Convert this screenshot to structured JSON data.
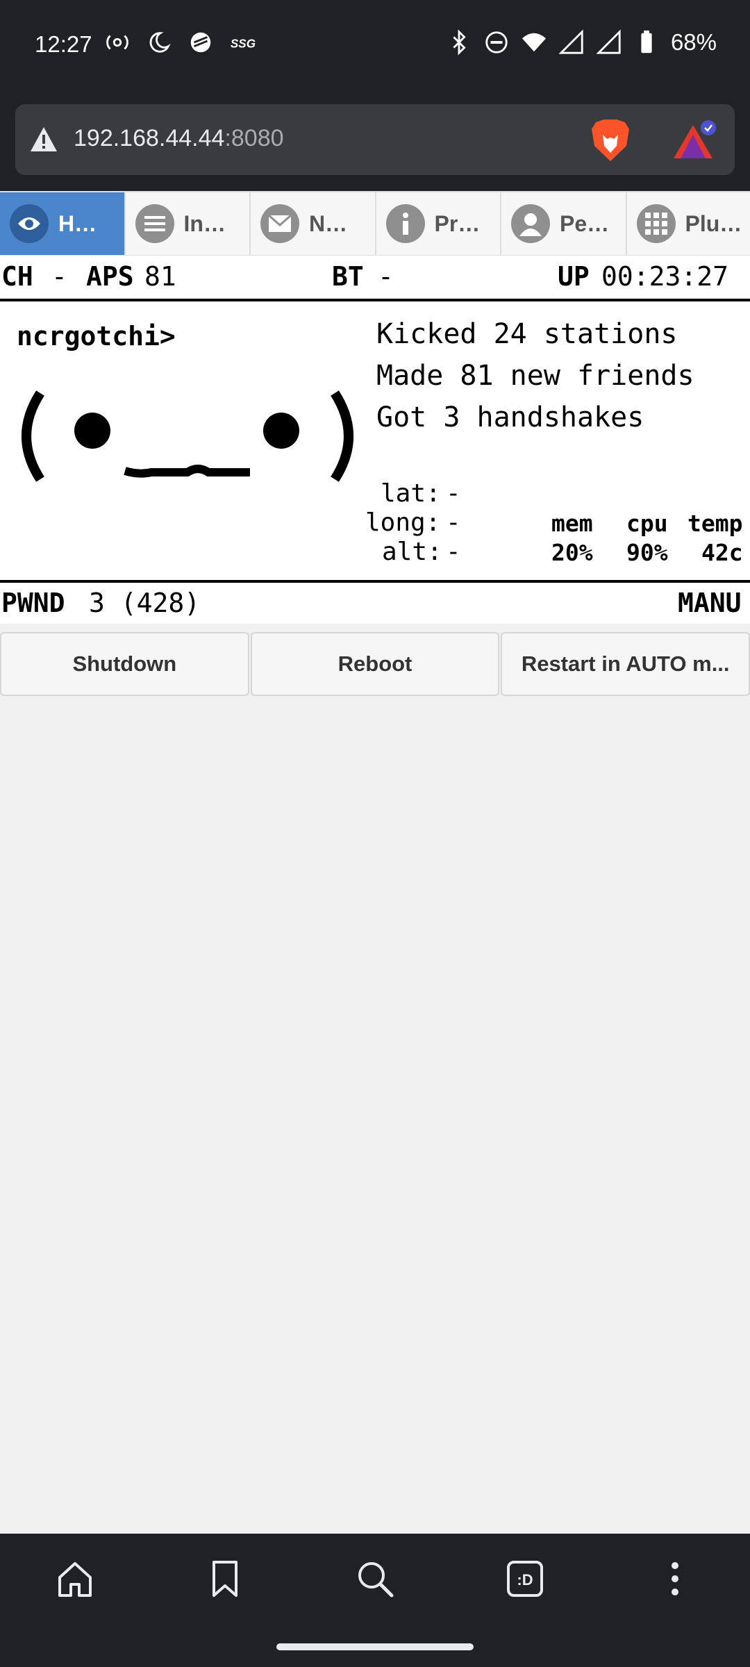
{
  "status_bar": {
    "time": "12:27",
    "left_icons": [
      "hotspot-icon",
      "do-not-disturb-moon-icon",
      "app-notification-icon",
      "ssg-icon"
    ],
    "right_icons": [
      "bluetooth-icon",
      "dnd-icon",
      "wifi-icon",
      "signal-icon",
      "signal-icon",
      "battery-icon"
    ],
    "battery": "68%"
  },
  "browser": {
    "url_host": "192.168.44.44",
    "url_port": ":8080",
    "security_icon": "warning-triangle-icon",
    "brand_icon": "brave-lion-icon",
    "rewards_icon": "brave-rewards-icon"
  },
  "tabs": [
    {
      "label": "H…",
      "icon": "eye-icon",
      "active": true
    },
    {
      "label": "In…",
      "icon": "list-icon",
      "active": false
    },
    {
      "label": "N…",
      "icon": "mail-icon",
      "active": false
    },
    {
      "label": "Pr…",
      "icon": "info-icon",
      "active": false
    },
    {
      "label": "Pe…",
      "icon": "person-icon",
      "active": false
    },
    {
      "label": "Plu…",
      "icon": "grid-icon",
      "active": false
    }
  ],
  "pwnagotchi": {
    "ch_label": "CH",
    "ch_value": "-",
    "aps_label": "APS",
    "aps_value": "81",
    "bt_label": "BT",
    "bt_value": "-",
    "up_label": "UP",
    "up_value": "00:23:27",
    "name": "ncrgotchi>",
    "face": "( ●   ● )",
    "status_lines": [
      "Kicked 24 stations",
      "Made 81 new friends",
      "Got 3 handshakes"
    ],
    "gps": {
      "lat_label": "lat:",
      "lat": "-",
      "long_label": "long:",
      "long": "-",
      "alt_label": "alt:",
      "alt": "-"
    },
    "stats": {
      "mem_label": "mem",
      "mem": "20%",
      "cpu_label": "cpu",
      "cpu": "90%",
      "temp_label": "temp",
      "temp": "42c"
    },
    "pwnd_label": "PWND",
    "pwnd_value": "3 (428)",
    "mode": "MANU"
  },
  "buttons": {
    "shutdown": "Shutdown",
    "reboot": "Reboot",
    "restart_auto": "Restart in AUTO m..."
  },
  "bottom_nav": [
    "home-icon",
    "bookmark-icon",
    "search-icon",
    "tabs-icon",
    "more-vert-icon"
  ],
  "bottom_nav_tabs_label": ":D"
}
